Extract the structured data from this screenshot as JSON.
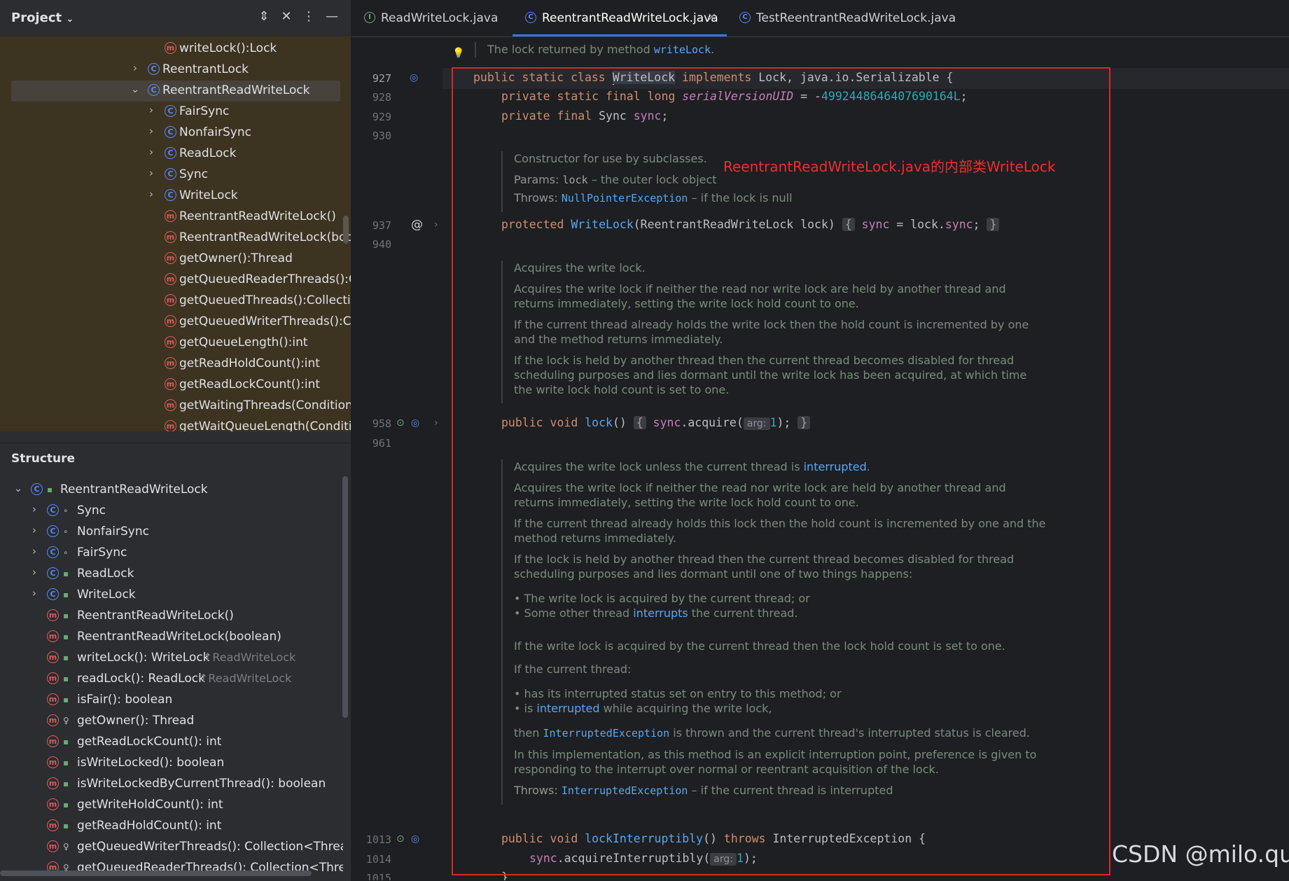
{
  "project": {
    "title": "Project",
    "tree": [
      {
        "label": "writeLock():Lock",
        "icon": "method-icon"
      },
      {
        "label": "ReentrantLock",
        "icon": "class-icon"
      },
      {
        "label": "ReentrantReadWriteLock",
        "icon": "class-icon"
      },
      {
        "label": "FairSync",
        "icon": "class-icon"
      },
      {
        "label": "NonfairSync",
        "icon": "class-icon"
      },
      {
        "label": "ReadLock",
        "icon": "class-icon"
      },
      {
        "label": "Sync",
        "icon": "class-icon"
      },
      {
        "label": "WriteLock",
        "icon": "class-icon"
      },
      {
        "label": "ReentrantReadWriteLock()",
        "icon": "method-icon"
      },
      {
        "label": "ReentrantReadWriteLock(boolea",
        "icon": "method-icon"
      },
      {
        "label": "getOwner():Thread",
        "icon": "method-icon"
      },
      {
        "label": "getQueuedReaderThreads():Coll",
        "icon": "method-icon"
      },
      {
        "label": "getQueuedThreads():Collection<",
        "icon": "method-icon"
      },
      {
        "label": "getQueuedWriterThreads():Colle",
        "icon": "method-icon"
      },
      {
        "label": "getQueueLength():int",
        "icon": "method-icon"
      },
      {
        "label": "getReadHoldCount():int",
        "icon": "method-icon"
      },
      {
        "label": "getReadLockCount():int",
        "icon": "method-icon"
      },
      {
        "label": "getWaitingThreads(Condition):C",
        "icon": "method-icon"
      },
      {
        "label": "getWaitQueueLength(Condition)",
        "icon": "method-icon"
      }
    ]
  },
  "structure": {
    "title": "Structure",
    "root": "ReentrantReadWriteLock",
    "items": [
      {
        "label": "Sync",
        "icon": "class-icon"
      },
      {
        "label": "NonfairSync",
        "icon": "class-icon"
      },
      {
        "label": "FairSync",
        "icon": "class-icon"
      },
      {
        "label": "ReadLock",
        "icon": "class-icon"
      },
      {
        "label": "WriteLock",
        "icon": "class-icon"
      },
      {
        "label": "ReentrantReadWriteLock()",
        "icon": "method-icon"
      },
      {
        "label": "ReentrantReadWriteLock(boolean)",
        "icon": "method-icon"
      },
      {
        "label": "writeLock(): WriteLock",
        "icon": "method-icon",
        "override": "↑ReadWriteLock"
      },
      {
        "label": "readLock(): ReadLock",
        "icon": "method-icon",
        "override": "↑ReadWriteLock"
      },
      {
        "label": "isFair(): boolean",
        "icon": "method-icon"
      },
      {
        "label": "getOwner(): Thread",
        "icon": "method-icon"
      },
      {
        "label": "getReadLockCount(): int",
        "icon": "method-icon"
      },
      {
        "label": "isWriteLocked(): boolean",
        "icon": "method-icon"
      },
      {
        "label": "isWriteLockedByCurrentThread(): boolean",
        "icon": "method-icon"
      },
      {
        "label": "getWriteHoldCount(): int",
        "icon": "method-icon"
      },
      {
        "label": "getReadHoldCount(): int",
        "icon": "method-icon"
      },
      {
        "label": "getQueuedWriterThreads(): Collection<Thread>",
        "icon": "method-icon"
      },
      {
        "label": "getQueuedReaderThreads(): Collection<Thread>",
        "icon": "method-icon"
      }
    ]
  },
  "tabs": [
    {
      "label": "ReadWriteLock.java",
      "active": false
    },
    {
      "label": "ReentrantReadWriteLock.java",
      "active": true
    },
    {
      "label": "TestReentrantReadWriteLock.java",
      "active": false
    }
  ],
  "editor": {
    "top_doc": {
      "text": "The lock returned by method ",
      "code": "writeLock",
      "end": "."
    },
    "line_numbers": [
      "927",
      "928",
      "929",
      "930",
      "937",
      "940",
      "958",
      "961",
      "1013",
      "1014",
      "1015"
    ],
    "code": {
      "l927_a": "public static class ",
      "l927_word": "WriteLock",
      "l927_b": " implements Lock, java.io.Serializable {",
      "l928_kw": "private static final long ",
      "l928_field": "serialVersionUID",
      "l928_eq": " = -",
      "l928_num": "4992448646407690164L",
      "l928_end": ";",
      "l929_kw": "private final ",
      "l929_type": "Sync ",
      "l929_field": "sync",
      "l929_end": ";",
      "l937_kw": "protected ",
      "l937_fn": "WriteLock",
      "l937_params": "(ReentrantReadWriteLock lock) ",
      "l937_fold_open": "{",
      "l937_field1": " sync",
      "l937_mid": " = lock.",
      "l937_field2": "sync",
      "l937_semi": "; ",
      "l937_fold_close": "}",
      "l958_kw": "public void ",
      "l958_fn": "lock",
      "l958_paren": "() ",
      "l958_fold_open": "{",
      "l958_field": " sync",
      "l958_call": ".acquire(",
      "l958_hint": "arg:",
      "l958_num": "1",
      "l958_end": "); ",
      "l958_fold_close": "}",
      "l1013_kw": "public void ",
      "l1013_fn": "lockInterruptibly",
      "l1013_paren": "() ",
      "l1013_throws": "throws",
      "l1013_rest": " InterruptedException {",
      "l1014_field": "sync",
      "l1014_call": ".acquireInterruptibly(",
      "l1014_hint": "arg:",
      "l1014_num": "1",
      "l1014_end": ");",
      "l1015": "}"
    },
    "doc_ctor": {
      "desc": "Constructor for use by subclasses.",
      "params_tag": "Params:",
      "params_code": "lock",
      "params_text": " – the outer lock object",
      "throws_tag": "Throws:",
      "throws_code": "NullPointerException",
      "throws_text": " – if the lock is null"
    },
    "doc_lock": {
      "p1": "Acquires the write lock.",
      "p2": "Acquires the write lock if neither the read nor write lock are held by another thread and returns immediately, setting the write lock hold count to one.",
      "p3": "If the current thread already holds the write lock then the hold count is incremented by one and the method returns immediately.",
      "p4": "If the lock is held by another thread then the current thread becomes disabled for thread scheduling purposes and lies dormant until the write lock has been acquired, at which time the write lock hold count is set to one."
    },
    "doc_interruptibly": {
      "p1_a": "Acquires the write lock unless the current thread is ",
      "p1_link": "interrupted",
      "p1_b": ".",
      "p2": "Acquires the write lock if neither the read nor write lock are held by another thread and returns immediately, setting the write lock hold count to one.",
      "p3": "If the current thread already holds this lock then the hold count is incremented by one and the method returns immediately.",
      "p4": "If the lock is held by another thread then the current thread becomes disabled for thread scheduling purposes and lies dormant until one of two things happens:",
      "li1": "The write lock is acquired by the current thread; or",
      "li2_a": "Some other thread ",
      "li2_link": "interrupts",
      "li2_b": " the current thread.",
      "p5": "If the write lock is acquired by the current thread then the lock hold count is set to one.",
      "p6": "If the current thread:",
      "li3": "has its interrupted status set on entry to this method; or",
      "li4_a": "is ",
      "li4_link": "interrupted",
      "li4_b": " while acquiring the write lock,",
      "p7_a": "then ",
      "p7_code": "InterruptedException",
      "p7_b": " is thrown and the current thread's interrupted status is cleared.",
      "p8": "In this implementation, as this method is an explicit interruption point, preference is given to responding to the interrupt over normal or reentrant acquisition of the lock.",
      "throws_tag": "Throws:",
      "throws_code": "InterruptedException",
      "throws_text": " – if the current thread is interrupted"
    }
  },
  "annotation": "ReentrantReadWriteLock.java的内部类WriteLock",
  "watermark": "CSDN @milo.qu",
  "colors": {
    "annotation": "#ef2d2d",
    "accent": "#3574f0",
    "project_bg": "#3d3321"
  }
}
